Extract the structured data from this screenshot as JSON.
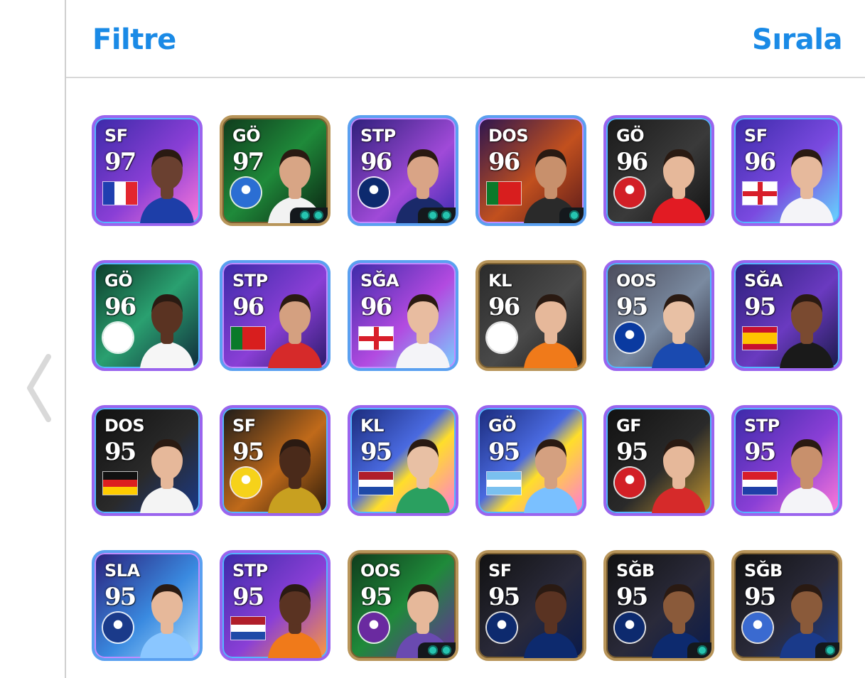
{
  "header": {
    "filter_label": "Filtre",
    "sort_label": "Sırala"
  },
  "colors": {
    "accent": "#1a8ae6",
    "divider": "#d8d8d8",
    "skill": "#26c4b0"
  },
  "cards": [
    {
      "pos": "SF",
      "rating": "97",
      "badge": "flag-france",
      "border": "purple",
      "bg": "linear-gradient(135deg,#3b2aa8,#8a3fd6 55%,#ff7ad9)",
      "skin": "#6a4030",
      "shirt": "#1d3ea8",
      "skills": 0
    },
    {
      "pos": "GÖ",
      "rating": "97",
      "badge": "club-crest",
      "crest_color": "#2b6ed3",
      "border": "gold",
      "bg": "linear-gradient(135deg,#0f3a1c,#1f8a3a 50%,#0a1f10)",
      "skin": "#d8a585",
      "shirt": "#f2f2f2",
      "skills": 2
    },
    {
      "pos": "STP",
      "rating": "96",
      "badge": "club-crest",
      "crest_color": "#0d2a6e",
      "border": "blue",
      "bg": "linear-gradient(135deg,#2d1f7a,#a04ad8 60%,#3a2ab0)",
      "skin": "#d9a486",
      "shirt": "#1a2a6a",
      "skills": 2
    },
    {
      "pos": "DOS",
      "rating": "96",
      "badge": "flag-portugal",
      "border": "blue",
      "bg": "linear-gradient(135deg,#2a1450,#c2501e 55%,#5a1a1a)",
      "skin": "#c8906c",
      "shirt": "#2a2a2a",
      "skills": 1
    },
    {
      "pos": "GÖ",
      "rating": "96",
      "badge": "club-crest",
      "crest_color": "#d21f26",
      "border": "purple",
      "bg": "linear-gradient(135deg,#1a1a1a,#3a3a3a 55%,#111)",
      "skin": "#e6b89a",
      "shirt": "#e21b23",
      "skills": 0
    },
    {
      "pos": "SF",
      "rating": "96",
      "badge": "flag-england",
      "border": "purple",
      "bg": "linear-gradient(135deg,#3b2aa8,#7a4ae0 55%,#66d9ff)",
      "skin": "#e6b99c",
      "shirt": "#f4f4f8",
      "skills": 0
    },
    {
      "pos": "GÖ",
      "rating": "96",
      "badge": "club-crest",
      "crest_color": "#ffffff",
      "border": "purple",
      "bg": "linear-gradient(135deg,#0d3b2a,#2aa070 50%,#102a3a)",
      "skin": "#5a3322",
      "shirt": "#f6f6f6",
      "skills": 0
    },
    {
      "pos": "STP",
      "rating": "96",
      "badge": "flag-portugal",
      "border": "blue",
      "bg": "linear-gradient(135deg,#3b2aa8,#8a3fd6 55%,#2a1a6a)",
      "skin": "#d4a080",
      "shirt": "#d62a2a",
      "skills": 0
    },
    {
      "pos": "SĞA",
      "rating": "96",
      "badge": "flag-england",
      "border": "blue",
      "bg": "linear-gradient(135deg,#3b2aa8,#b24ae0 55%,#7ad0ff)",
      "skin": "#e8bca0",
      "shirt": "#f4f4f8",
      "skills": 0
    },
    {
      "pos": "KL",
      "rating": "96",
      "badge": "club-crest",
      "crest_color": "#ffffff",
      "border": "gold",
      "bg": "linear-gradient(135deg,#2a2a2a,#4a4a4a 55%,#1a1a1a)",
      "skin": "#e6b89a",
      "shirt": "#f07a1a",
      "skills": 0
    },
    {
      "pos": "OOS",
      "rating": "95",
      "badge": "club-crest",
      "crest_color": "#0a3aa0",
      "border": "purple",
      "bg": "linear-gradient(135deg,#4a4a5a,#7a8aa0 55%,#2a2a3a)",
      "skin": "#e8c0a4",
      "shirt": "#1a4ab0",
      "skills": 0
    },
    {
      "pos": "SĞA",
      "rating": "95",
      "badge": "flag-spain",
      "border": "purple",
      "bg": "linear-gradient(135deg,#2a1f7a,#6a3ac0 55%,#1a1a4a)",
      "skin": "#7a4a30",
      "shirt": "#1a1a1a",
      "skills": 0
    },
    {
      "pos": "DOS",
      "rating": "95",
      "badge": "flag-germany",
      "border": "purple",
      "bg": "linear-gradient(135deg,#111,#2a2a2a 55%,#1a3a8a)",
      "skin": "#e6b89a",
      "shirt": "#f4f4f4",
      "skills": 0
    },
    {
      "pos": "SF",
      "rating": "95",
      "badge": "club-crest",
      "crest_color": "#f6d21a",
      "border": "purple",
      "bg": "linear-gradient(135deg,#1a1a1a,#c06a1a 55%,#2a1a0a)",
      "skin": "#4a2a1a",
      "shirt": "#c8a020",
      "skills": 0
    },
    {
      "pos": "KL",
      "rating": "95",
      "badge": "flag-netherlands",
      "border": "purple",
      "bg": "linear-gradient(135deg,#1a2a7a,#4a6ae0 45%,#ffde2a 60%,#ff7ad9)",
      "skin": "#e8c0a4",
      "shirt": "#2aa060",
      "skills": 0
    },
    {
      "pos": "GÖ",
      "rating": "95",
      "badge": "flag-argentina",
      "border": "purple",
      "bg": "linear-gradient(135deg,#1a2a7a,#4a6ae0 45%,#ffde2a 60%,#ff7ad9)",
      "skin": "#d4a080",
      "shirt": "#7ac0ff",
      "skills": 0
    },
    {
      "pos": "GF",
      "rating": "95",
      "badge": "club-crest",
      "crest_color": "#d21f26",
      "border": "purple",
      "bg": "linear-gradient(135deg,#111,#2a2a2a 55%,#c89a30)",
      "skin": "#e6b89a",
      "shirt": "#d62a2a",
      "skills": 0
    },
    {
      "pos": "STP",
      "rating": "95",
      "badge": "flag-croatia",
      "border": "purple",
      "bg": "linear-gradient(135deg,#3b2aa8,#8a3fd6 55%,#ff7ad9)",
      "skin": "#c8906c",
      "shirt": "#f4f4f8",
      "skills": 0
    },
    {
      "pos": "SLA",
      "rating": "95",
      "badge": "club-crest",
      "crest_color": "#1a3a8a",
      "border": "blue",
      "bg": "linear-gradient(135deg,#2a1f7a,#3a8ae0 55%,#aee0ff)",
      "skin": "#e6b89a",
      "shirt": "#8ac6ff",
      "skills": 0
    },
    {
      "pos": "STP",
      "rating": "95",
      "badge": "flag-netherlands",
      "border": "purple",
      "bg": "linear-gradient(135deg,#3b2aa8,#8a3fd6 55%,#ff9a3a)",
      "skin": "#5a3322",
      "shirt": "#f07a1a",
      "skills": 0
    },
    {
      "pos": "OOS",
      "rating": "95",
      "badge": "club-crest",
      "crest_color": "#6a2aa0",
      "border": "gold",
      "bg": "linear-gradient(135deg,#0f3a1c,#1f8a3a 50%,#6a2aa0)",
      "skin": "#e6b89a",
      "shirt": "#6a4ab0",
      "skills": 2
    },
    {
      "pos": "SF",
      "rating": "95",
      "badge": "club-crest",
      "crest_color": "#0d2a6e",
      "border": "gold",
      "bg": "linear-gradient(135deg,#111,#2a2a3a 55%,#0a1a4a)",
      "skin": "#5a3322",
      "shirt": "#0d2a6e",
      "skills": 0
    },
    {
      "pos": "SĞB",
      "rating": "95",
      "badge": "club-crest",
      "crest_color": "#0d2a6e",
      "border": "gold",
      "bg": "linear-gradient(135deg,#111,#2a2a3a 55%,#0a1a4a)",
      "skin": "#8a5a3a",
      "shirt": "#0d2a6e",
      "skills": 1
    },
    {
      "pos": "SĞB",
      "rating": "95",
      "badge": "club-crest",
      "crest_color": "#3a6ad0",
      "border": "gold",
      "bg": "linear-gradient(135deg,#111,#2a2a3a 55%,#1a3a8a)",
      "skin": "#8a5a3a",
      "shirt": "#1a3a8a",
      "skills": 1
    }
  ]
}
